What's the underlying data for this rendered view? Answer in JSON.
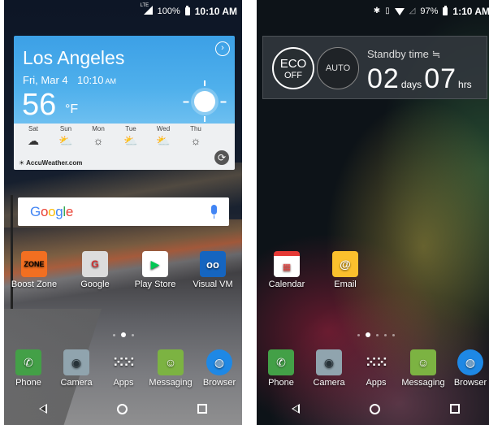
{
  "left": {
    "status": {
      "network": "LTE",
      "battery": "100%",
      "time": "10:10 AM"
    },
    "weather": {
      "city": "Los Angeles",
      "date": "Fri, Mar 4",
      "time": "10:10",
      "ampm": "AM",
      "temperature": "56",
      "unit": "°F",
      "forecast": [
        {
          "day": "Sat",
          "icon": "cloudy-icon"
        },
        {
          "day": "Sun",
          "icon": "partly-cloudy-icon"
        },
        {
          "day": "Mon",
          "icon": "sunny-icon"
        },
        {
          "day": "Tue",
          "icon": "partly-sunny-icon"
        },
        {
          "day": "Wed",
          "icon": "partly-cloudy-icon"
        },
        {
          "day": "Thu",
          "icon": "sunny-icon"
        }
      ],
      "provider": "AccuWeather.com"
    },
    "search": {
      "logo": "Google"
    },
    "apps": [
      {
        "label": "Boost Zone",
        "color": "#f26f21"
      },
      {
        "label": "Google",
        "color": "#dcdcdc"
      },
      {
        "label": "Play Store",
        "color": "#ffffff"
      },
      {
        "label": "Visual VM",
        "color": "#1565c0"
      }
    ],
    "dock": [
      {
        "label": "Phone",
        "color": "#43a047"
      },
      {
        "label": "Camera",
        "color": "#90a4ae"
      },
      {
        "label": "Apps",
        "color": "#ffffff"
      },
      {
        "label": "Messaging",
        "color": "#7cb342"
      },
      {
        "label": "Browser",
        "color": "#1e88e5"
      }
    ]
  },
  "right": {
    "status": {
      "battery": "97%",
      "time": "1:10 AM"
    },
    "eco": {
      "eco_label": "ECO",
      "eco_state": "OFF",
      "auto_label": "AUTO",
      "standby_label": "Standby time ≒",
      "days_value": "02",
      "days_unit": "days",
      "hours_value": "07",
      "hours_unit": "hrs"
    },
    "apps": [
      {
        "label": "Calendar",
        "color": "#ffffff"
      },
      {
        "label": "Email",
        "color": "#fbc02d"
      }
    ],
    "dock": [
      {
        "label": "Phone",
        "color": "#43a047"
      },
      {
        "label": "Camera",
        "color": "#90a4ae"
      },
      {
        "label": "Apps",
        "color": "#ffffff"
      },
      {
        "label": "Messaging",
        "color": "#7cb342"
      },
      {
        "label": "Browser",
        "color": "#1e88e5"
      }
    ]
  }
}
